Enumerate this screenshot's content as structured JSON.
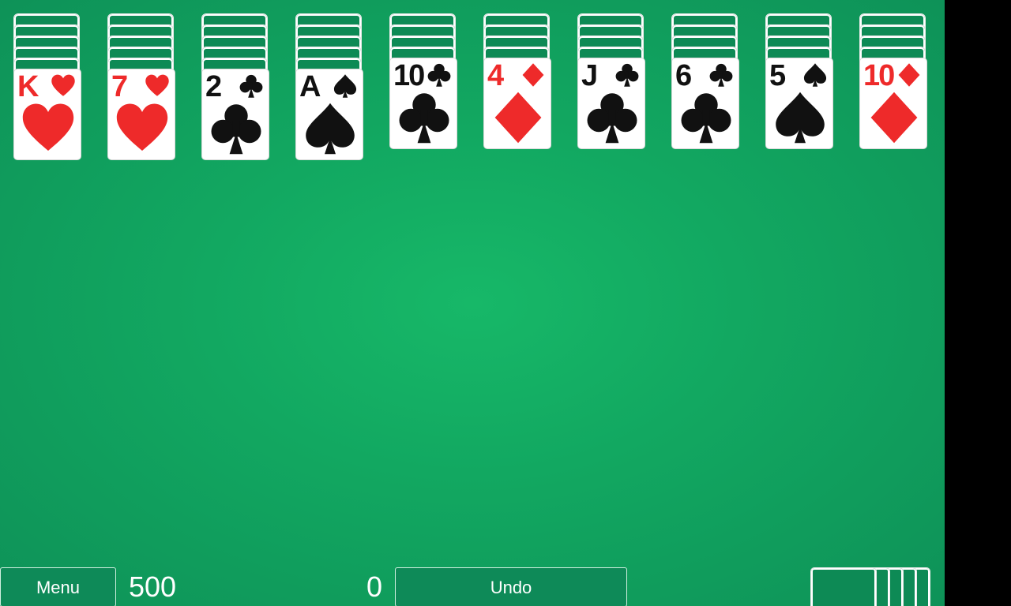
{
  "game": "spider-solitaire",
  "colors": {
    "felt": "#12a861",
    "red_suit": "#ee2a2a",
    "black_suit": "#111111",
    "button_bg": "#0e8a58",
    "card_back": "#0d8a55"
  },
  "tableau": [
    {
      "rank": "K",
      "suit": "hearts",
      "color": "red",
      "facedown_count": 5
    },
    {
      "rank": "7",
      "suit": "hearts",
      "color": "red",
      "facedown_count": 5
    },
    {
      "rank": "2",
      "suit": "clubs",
      "color": "black",
      "facedown_count": 5
    },
    {
      "rank": "A",
      "suit": "spades",
      "color": "black",
      "facedown_count": 5
    },
    {
      "rank": "10",
      "suit": "clubs",
      "color": "black",
      "facedown_count": 4
    },
    {
      "rank": "4",
      "suit": "diamonds",
      "color": "red",
      "facedown_count": 4
    },
    {
      "rank": "J",
      "suit": "clubs",
      "color": "black",
      "facedown_count": 4
    },
    {
      "rank": "6",
      "suit": "clubs",
      "color": "black",
      "facedown_count": 4
    },
    {
      "rank": "5",
      "suit": "spades",
      "color": "black",
      "facedown_count": 4
    },
    {
      "rank": "10",
      "suit": "diamonds",
      "color": "red",
      "facedown_count": 4
    }
  ],
  "toolbar": {
    "menu_label": "Menu",
    "score": "500",
    "moves": "0",
    "undo_label": "Undo"
  },
  "stock": {
    "remaining_deals": 5
  },
  "navbar": {
    "icons": [
      "recent-apps-icon",
      "home-icon",
      "back-icon"
    ]
  }
}
